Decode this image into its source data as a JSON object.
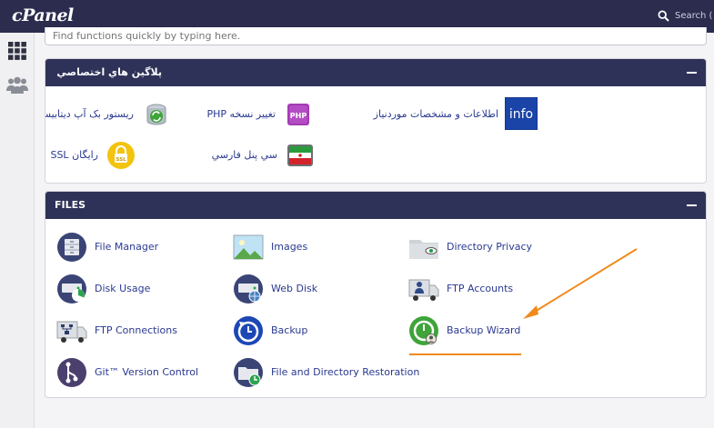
{
  "header": {
    "logo_text": "cPanel",
    "search_label": "Search ( /"
  },
  "sidebar": {
    "items": [
      {
        "icon": "grid-icon"
      },
      {
        "icon": "users-icon"
      }
    ]
  },
  "quick_search": {
    "placeholder": "Find functions quickly by typing here."
  },
  "plugins_panel": {
    "title": "پلاگین هاي اختصاصي",
    "items": [
      {
        "label": "اطلاعات و مشخصات موردنیاز",
        "icon_text": "info",
        "icon_color": "#1a44a8"
      },
      {
        "label": "PHP تغییر نسخه",
        "icon_text": "PHP",
        "icon_color": "#a23bb3"
      },
      {
        "label": "ريستور بک آپ ديتابيس",
        "icon": "db-restore-icon"
      },
      {
        "label": "سي پنل فارسي",
        "icon": "iran-flag-icon"
      },
      {
        "label": "SSL رایگان",
        "icon_text": "SSL",
        "icon_color": "#f2c40f"
      }
    ]
  },
  "files_panel": {
    "title": "FILES",
    "items": [
      {
        "label": "File Manager",
        "icon": "file-manager-icon"
      },
      {
        "label": "Images",
        "icon": "images-icon"
      },
      {
        "label": "Directory Privacy",
        "icon": "directory-privacy-icon"
      },
      {
        "label": "Disk Usage",
        "icon": "disk-usage-icon"
      },
      {
        "label": "Web Disk",
        "icon": "web-disk-icon"
      },
      {
        "label": "FTP Accounts",
        "icon": "ftp-accounts-icon"
      },
      {
        "label": "FTP Connections",
        "icon": "ftp-connections-icon"
      },
      {
        "label": "Backup",
        "icon": "backup-icon"
      },
      {
        "label": "Backup Wizard",
        "icon": "backup-wizard-icon"
      },
      {
        "label": "Git™ Version Control",
        "icon": "git-icon"
      },
      {
        "label": "File and Directory Restoration",
        "icon": "file-restoration-icon"
      }
    ]
  },
  "annotation": {
    "color": "#f08a1c"
  }
}
